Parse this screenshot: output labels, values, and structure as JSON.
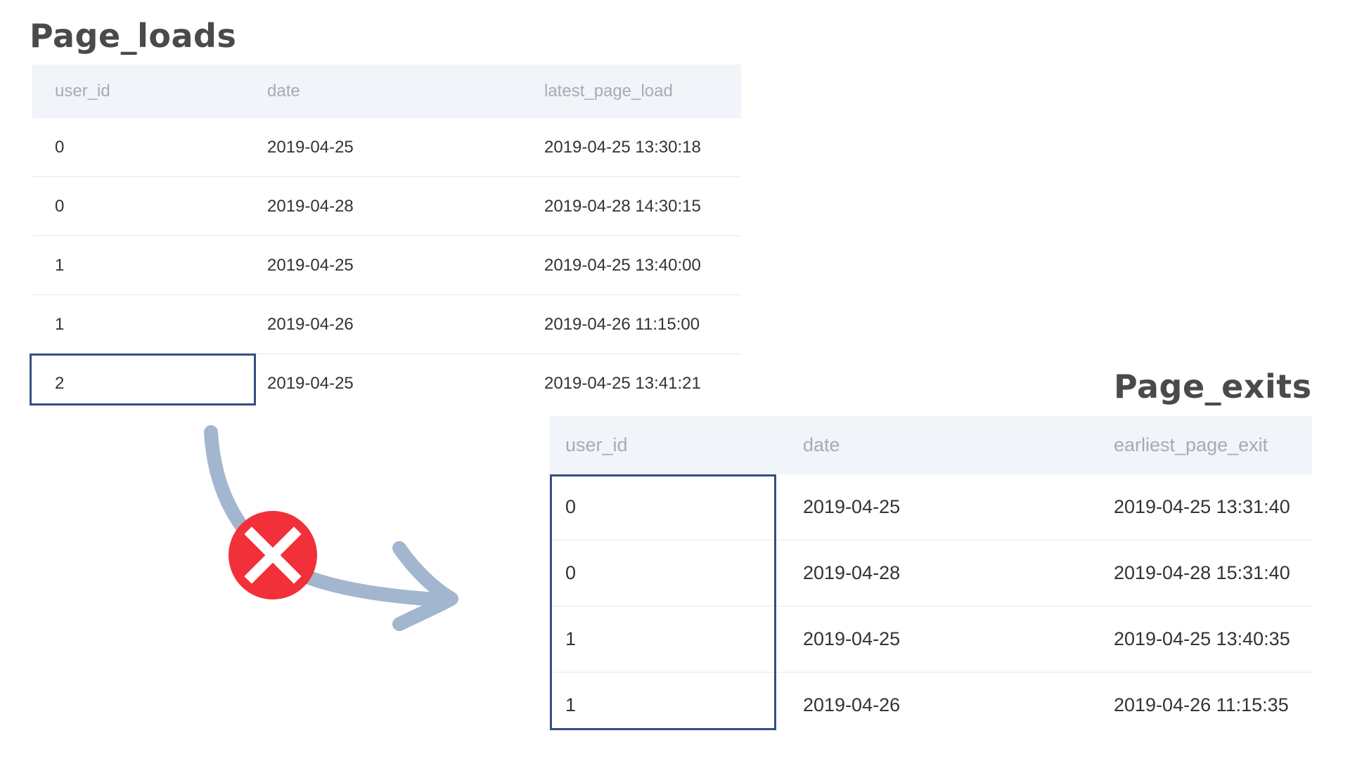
{
  "page_loads": {
    "title": "Page_loads",
    "columns": [
      "user_id",
      "date",
      "latest_page_load"
    ],
    "rows": [
      [
        "0",
        "2019-04-25",
        "2019-04-25 13:30:18"
      ],
      [
        "0",
        "2019-04-28",
        "2019-04-28 14:30:15"
      ],
      [
        "1",
        "2019-04-25",
        "2019-04-25 13:40:00"
      ],
      [
        "1",
        "2019-04-26",
        "2019-04-26 11:15:00"
      ],
      [
        "2",
        "2019-04-25",
        "2019-04-25 13:41:21"
      ]
    ],
    "highlighted_rows": [
      4
    ]
  },
  "page_exits": {
    "title": "Page_exits",
    "columns": [
      "user_id",
      "date",
      "earliest_page_exit"
    ],
    "rows": [
      [
        "0",
        "2019-04-25",
        "2019-04-25 13:31:40"
      ],
      [
        "0",
        "2019-04-28",
        "2019-04-28 15:31:40"
      ],
      [
        "1",
        "2019-04-25",
        "2019-04-25 13:40:35"
      ],
      [
        "1",
        "2019-04-26",
        "2019-04-26 11:15:35"
      ]
    ],
    "highlighted_rows": [
      0,
      1,
      2,
      3
    ]
  },
  "connector": {
    "icon": "x-circle-icon",
    "meaning": "no match",
    "arrow_color": "#a2b6cf",
    "icon_color": "#f2303a"
  },
  "colors": {
    "title_text": "#4a4a4a",
    "header_bg": "#f1f4f8",
    "header_text": "#a3acb9",
    "cell_text": "#333333",
    "row_divider": "#e5e8ec",
    "highlight_border": "#34507e"
  }
}
